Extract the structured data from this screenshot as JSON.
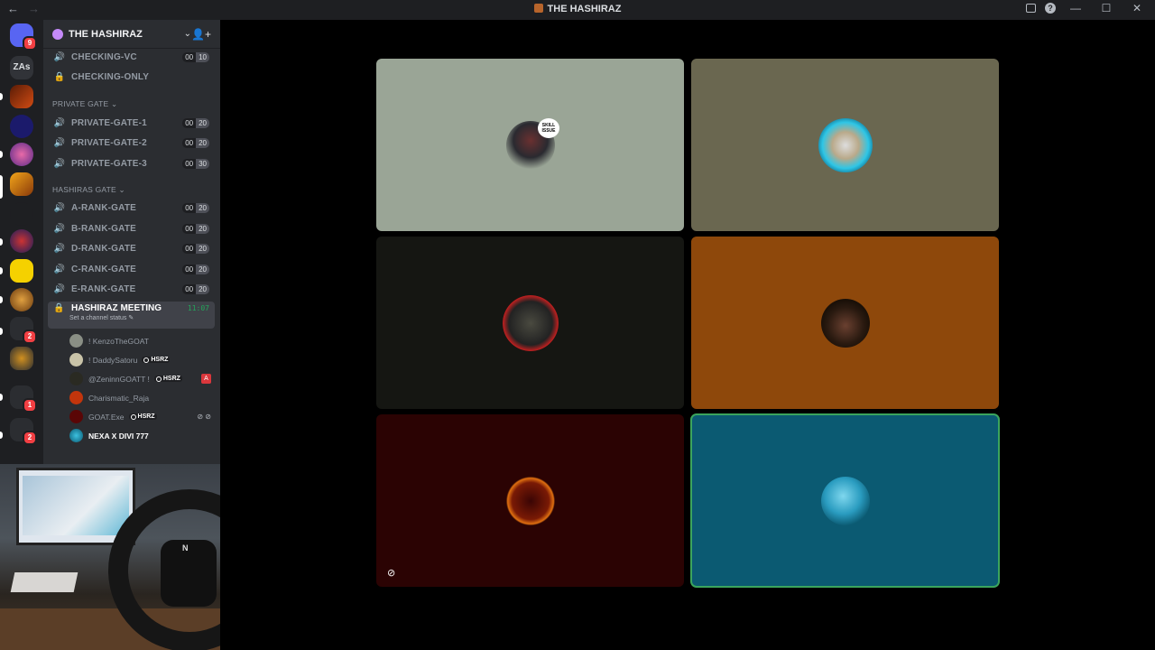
{
  "window": {
    "title": "THE HASHIRAZ",
    "nav_back": "←",
    "nav_forward": "→",
    "help": "?",
    "minimize": "—",
    "maximize": "☐",
    "close": "✕"
  },
  "guilds": {
    "home_badge": "9",
    "zas_label": "ZAs",
    "badges": {
      "g11": "2",
      "g14": "1",
      "g15": "2"
    }
  },
  "server": {
    "name": "THE HASHIRAZ",
    "chevron": "⌄",
    "invite_icon": "👤+"
  },
  "channels_top": [
    {
      "name": "CHECKING-VC",
      "icon": "🔊",
      "cap": [
        "00",
        "10"
      ]
    },
    {
      "name": "CHECKING-ONLY",
      "icon": "🔒",
      "cap": null
    }
  ],
  "categories": {
    "private_gate": "PRIVATE GATE ⌄",
    "hashiras_gate": "HASHIRAS GATE ⌄"
  },
  "private_channels": [
    {
      "name": "PRIVATE-GATE-1",
      "cap": [
        "00",
        "20"
      ]
    },
    {
      "name": "PRIVATE-GATE-2",
      "cap": [
        "00",
        "20"
      ]
    },
    {
      "name": "PRIVATE-GATE-3",
      "cap": [
        "00",
        "30"
      ]
    }
  ],
  "hashira_channels": [
    {
      "name": "A-RANK-GATE",
      "cap": [
        "00",
        "20"
      ]
    },
    {
      "name": "B-RANK-GATE",
      "cap": [
        "00",
        "20"
      ]
    },
    {
      "name": "D-RANK-GATE",
      "cap": [
        "00",
        "20"
      ]
    },
    {
      "name": "C-RANK-GATE",
      "cap": [
        "00",
        "20"
      ]
    },
    {
      "name": "E-RANK-GATE",
      "cap": [
        "00",
        "20"
      ]
    }
  ],
  "active_channel": {
    "name": "HASHIRAZ MEETING",
    "time": "11:07",
    "status": "Set a channel status ✎"
  },
  "voice_users": [
    {
      "name": "! KenzoTheGOAT",
      "tag": ""
    },
    {
      "name": "! DaddySatoru",
      "tag": "HSRZ"
    },
    {
      "name": "@ZeninnGOATT !",
      "tag": "HSRZ"
    },
    {
      "name": "Charismatic_Raja",
      "tag": ""
    },
    {
      "name": "GOAT.Exe",
      "tag": "HSRZ"
    },
    {
      "name": "NEXA X DIVI 777",
      "tag": ""
    }
  ],
  "voice_extras": {
    "zeninn_icon": "A",
    "goat_icons": "⊘ ⊘"
  },
  "webcam": {
    "logo": "N"
  },
  "stage": {
    "bubble_text": "SKILL ISSUE",
    "tile_colors": [
      "#9aa596",
      "#6a6750",
      "#151612",
      "#8e480b",
      "#2b0303",
      "#0b5a72"
    ],
    "deafened_icon": "⊘"
  }
}
